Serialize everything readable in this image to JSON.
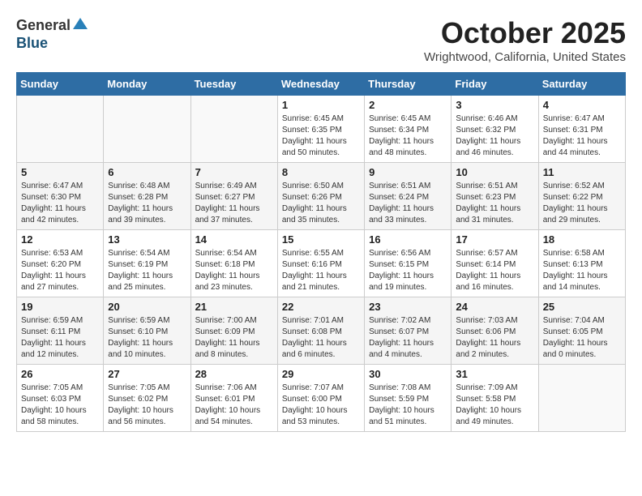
{
  "header": {
    "logo_general": "General",
    "logo_blue": "Blue",
    "month_title": "October 2025",
    "location": "Wrightwood, California, United States"
  },
  "weekdays": [
    "Sunday",
    "Monday",
    "Tuesday",
    "Wednesday",
    "Thursday",
    "Friday",
    "Saturday"
  ],
  "weeks": [
    [
      {
        "day": "",
        "info": ""
      },
      {
        "day": "",
        "info": ""
      },
      {
        "day": "",
        "info": ""
      },
      {
        "day": "1",
        "info": "Sunrise: 6:45 AM\nSunset: 6:35 PM\nDaylight: 11 hours and 50 minutes."
      },
      {
        "day": "2",
        "info": "Sunrise: 6:45 AM\nSunset: 6:34 PM\nDaylight: 11 hours and 48 minutes."
      },
      {
        "day": "3",
        "info": "Sunrise: 6:46 AM\nSunset: 6:32 PM\nDaylight: 11 hours and 46 minutes."
      },
      {
        "day": "4",
        "info": "Sunrise: 6:47 AM\nSunset: 6:31 PM\nDaylight: 11 hours and 44 minutes."
      }
    ],
    [
      {
        "day": "5",
        "info": "Sunrise: 6:47 AM\nSunset: 6:30 PM\nDaylight: 11 hours and 42 minutes."
      },
      {
        "day": "6",
        "info": "Sunrise: 6:48 AM\nSunset: 6:28 PM\nDaylight: 11 hours and 39 minutes."
      },
      {
        "day": "7",
        "info": "Sunrise: 6:49 AM\nSunset: 6:27 PM\nDaylight: 11 hours and 37 minutes."
      },
      {
        "day": "8",
        "info": "Sunrise: 6:50 AM\nSunset: 6:26 PM\nDaylight: 11 hours and 35 minutes."
      },
      {
        "day": "9",
        "info": "Sunrise: 6:51 AM\nSunset: 6:24 PM\nDaylight: 11 hours and 33 minutes."
      },
      {
        "day": "10",
        "info": "Sunrise: 6:51 AM\nSunset: 6:23 PM\nDaylight: 11 hours and 31 minutes."
      },
      {
        "day": "11",
        "info": "Sunrise: 6:52 AM\nSunset: 6:22 PM\nDaylight: 11 hours and 29 minutes."
      }
    ],
    [
      {
        "day": "12",
        "info": "Sunrise: 6:53 AM\nSunset: 6:20 PM\nDaylight: 11 hours and 27 minutes."
      },
      {
        "day": "13",
        "info": "Sunrise: 6:54 AM\nSunset: 6:19 PM\nDaylight: 11 hours and 25 minutes."
      },
      {
        "day": "14",
        "info": "Sunrise: 6:54 AM\nSunset: 6:18 PM\nDaylight: 11 hours and 23 minutes."
      },
      {
        "day": "15",
        "info": "Sunrise: 6:55 AM\nSunset: 6:16 PM\nDaylight: 11 hours and 21 minutes."
      },
      {
        "day": "16",
        "info": "Sunrise: 6:56 AM\nSunset: 6:15 PM\nDaylight: 11 hours and 19 minutes."
      },
      {
        "day": "17",
        "info": "Sunrise: 6:57 AM\nSunset: 6:14 PM\nDaylight: 11 hours and 16 minutes."
      },
      {
        "day": "18",
        "info": "Sunrise: 6:58 AM\nSunset: 6:13 PM\nDaylight: 11 hours and 14 minutes."
      }
    ],
    [
      {
        "day": "19",
        "info": "Sunrise: 6:59 AM\nSunset: 6:11 PM\nDaylight: 11 hours and 12 minutes."
      },
      {
        "day": "20",
        "info": "Sunrise: 6:59 AM\nSunset: 6:10 PM\nDaylight: 11 hours and 10 minutes."
      },
      {
        "day": "21",
        "info": "Sunrise: 7:00 AM\nSunset: 6:09 PM\nDaylight: 11 hours and 8 minutes."
      },
      {
        "day": "22",
        "info": "Sunrise: 7:01 AM\nSunset: 6:08 PM\nDaylight: 11 hours and 6 minutes."
      },
      {
        "day": "23",
        "info": "Sunrise: 7:02 AM\nSunset: 6:07 PM\nDaylight: 11 hours and 4 minutes."
      },
      {
        "day": "24",
        "info": "Sunrise: 7:03 AM\nSunset: 6:06 PM\nDaylight: 11 hours and 2 minutes."
      },
      {
        "day": "25",
        "info": "Sunrise: 7:04 AM\nSunset: 6:05 PM\nDaylight: 11 hours and 0 minutes."
      }
    ],
    [
      {
        "day": "26",
        "info": "Sunrise: 7:05 AM\nSunset: 6:03 PM\nDaylight: 10 hours and 58 minutes."
      },
      {
        "day": "27",
        "info": "Sunrise: 7:05 AM\nSunset: 6:02 PM\nDaylight: 10 hours and 56 minutes."
      },
      {
        "day": "28",
        "info": "Sunrise: 7:06 AM\nSunset: 6:01 PM\nDaylight: 10 hours and 54 minutes."
      },
      {
        "day": "29",
        "info": "Sunrise: 7:07 AM\nSunset: 6:00 PM\nDaylight: 10 hours and 53 minutes."
      },
      {
        "day": "30",
        "info": "Sunrise: 7:08 AM\nSunset: 5:59 PM\nDaylight: 10 hours and 51 minutes."
      },
      {
        "day": "31",
        "info": "Sunrise: 7:09 AM\nSunset: 5:58 PM\nDaylight: 10 hours and 49 minutes."
      },
      {
        "day": "",
        "info": ""
      }
    ]
  ]
}
